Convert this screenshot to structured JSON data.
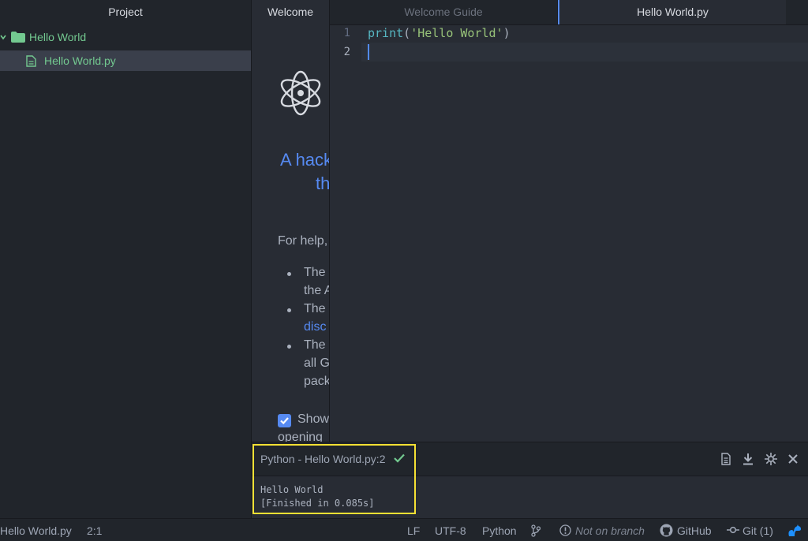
{
  "sidebar": {
    "title": "Project",
    "folder": {
      "name": "Hello World"
    },
    "file": {
      "name": "Hello World.py"
    }
  },
  "welcome": {
    "tab_label": "Welcome",
    "heading_line1": "A hack",
    "heading_line2": "th",
    "help_intro": "For help,",
    "bullet1_line1": "The",
    "bullet1_line2": "the A",
    "bullet2_line1": "The",
    "bullet2_line2": "disc",
    "bullet3_line1": "The",
    "bullet3_line2": "all G",
    "bullet3_line3": "pack",
    "show_label": "Show",
    "opening_label": "opening"
  },
  "tabs": [
    {
      "label": "Welcome Guide",
      "active": false
    },
    {
      "label": "Hello World.py",
      "active": true
    }
  ],
  "editor": {
    "lines": [
      {
        "number": "1",
        "text": "print('Hello World')"
      },
      {
        "number": "2",
        "text": ""
      }
    ],
    "code_fn": "print",
    "code_open": "(",
    "code_string": "'Hello World'",
    "code_close": ")"
  },
  "output": {
    "title": "Python - Hello World.py:2",
    "line1": "Hello World",
    "line2": "[Finished in 0.085s]"
  },
  "status": {
    "file": "Hello World.py",
    "cursor": "2:1",
    "line_ending": "LF",
    "encoding": "UTF-8",
    "grammar": "Python",
    "branch": "Not on branch",
    "github": "GitHub",
    "git": "Git (1)"
  },
  "colors": {
    "accent": "#568af2",
    "file_green": "#73c990",
    "string_green": "#98c379",
    "function_cyan": "#56b6c2",
    "highlight_yellow": "#f5e033",
    "success_green": "#73c990"
  }
}
